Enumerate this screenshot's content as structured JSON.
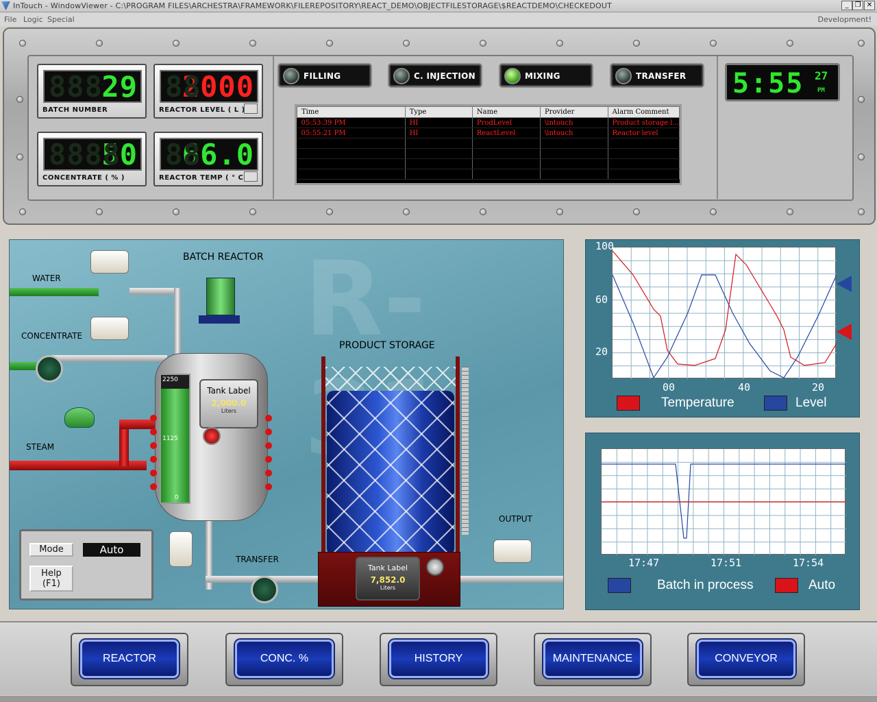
{
  "window": {
    "title": "InTouch - WindowViewer - C:\\PROGRAM FILES\\ARCHESTRA\\FRAMEWORK\\FILEREPOSITORY\\REACT_DEMO\\OBJECTFILESTORAGE\\$REACTDEMO\\CHECKEDOUT",
    "minimize": "_",
    "restore": "❐",
    "close": "✕"
  },
  "menu": {
    "file": "File",
    "logic": "Logic",
    "special": "Special",
    "mode": "Development!"
  },
  "meters": {
    "batch_number": {
      "value": "29",
      "label": "BATCH NUMBER",
      "color": "#32e632"
    },
    "reactor_level": {
      "value": "2000",
      "label": "REACTOR LEVEL  ( L )",
      "color": "#ff2020"
    },
    "concentrate": {
      "value": "50",
      "label": "CONCENTRATE  ( % )",
      "color": "#32e632"
    },
    "reactor_temp": {
      "value": "66.0",
      "label": "REACTOR TEMP  ( ° C )",
      "color": "#32e632"
    }
  },
  "status": [
    {
      "label": "FILLING",
      "on": false
    },
    {
      "label": "C. INJECTION",
      "on": false
    },
    {
      "label": "MIXING",
      "on": true
    },
    {
      "label": "TRANSFER",
      "on": false
    }
  ],
  "alarms": {
    "columns": [
      "Time",
      "Type",
      "Name",
      "Provider",
      "Alarm Comment"
    ],
    "rows": [
      [
        "05:53:39 PM",
        "HI",
        "ProdLevel",
        "\\intouch",
        "Product storage l..."
      ],
      [
        "05:55:21 PM",
        "HI",
        "ReactLevel",
        "\\intouch",
        "Reactor level"
      ]
    ]
  },
  "clock": {
    "hm": "5:55",
    "sec": "27",
    "ampm": "PM"
  },
  "process": {
    "watermark": "R-31",
    "batch_reactor": "BATCH REACTOR",
    "product_storage": "PRODUCT STORAGE",
    "water": "WATER",
    "concentrate": "CONCENTRATE",
    "steam": "STEAM",
    "transfer": "TRANSFER",
    "output": "OUTPUT",
    "reactor_scale": {
      "max": "2250",
      "mid": "1125",
      "min": "0"
    },
    "reactor_level_fraction": 0.89,
    "reactor_tank": {
      "title": "Tank Label",
      "value": "2,000.0",
      "unit": "Liters"
    },
    "storage_tank": {
      "title": "Tank Label",
      "value": "7,852.0",
      "unit": "Liters"
    },
    "mode_label": "Mode",
    "mode_value": "Auto",
    "help_line1": "Help",
    "help_line2": "(F1)"
  },
  "trend1": {
    "y_ticks": [
      "100",
      "60",
      "20"
    ],
    "x_ticks": [
      "00",
      "40",
      "20"
    ],
    "legend": [
      {
        "name": "Temperature",
        "color": "#d8141a"
      },
      {
        "name": "Level",
        "color": "#2746a0"
      }
    ]
  },
  "trend2": {
    "x_ticks": [
      "17:47",
      "17:51",
      "17:54"
    ],
    "legend": [
      {
        "name": "Batch in process",
        "color": "#2746a0"
      },
      {
        "name": "Auto",
        "color": "#d8141a"
      }
    ]
  },
  "nav": [
    "REACTOR",
    "CONC. %",
    "HISTORY",
    "MAINTENANCE",
    "CONVEYOR"
  ]
}
